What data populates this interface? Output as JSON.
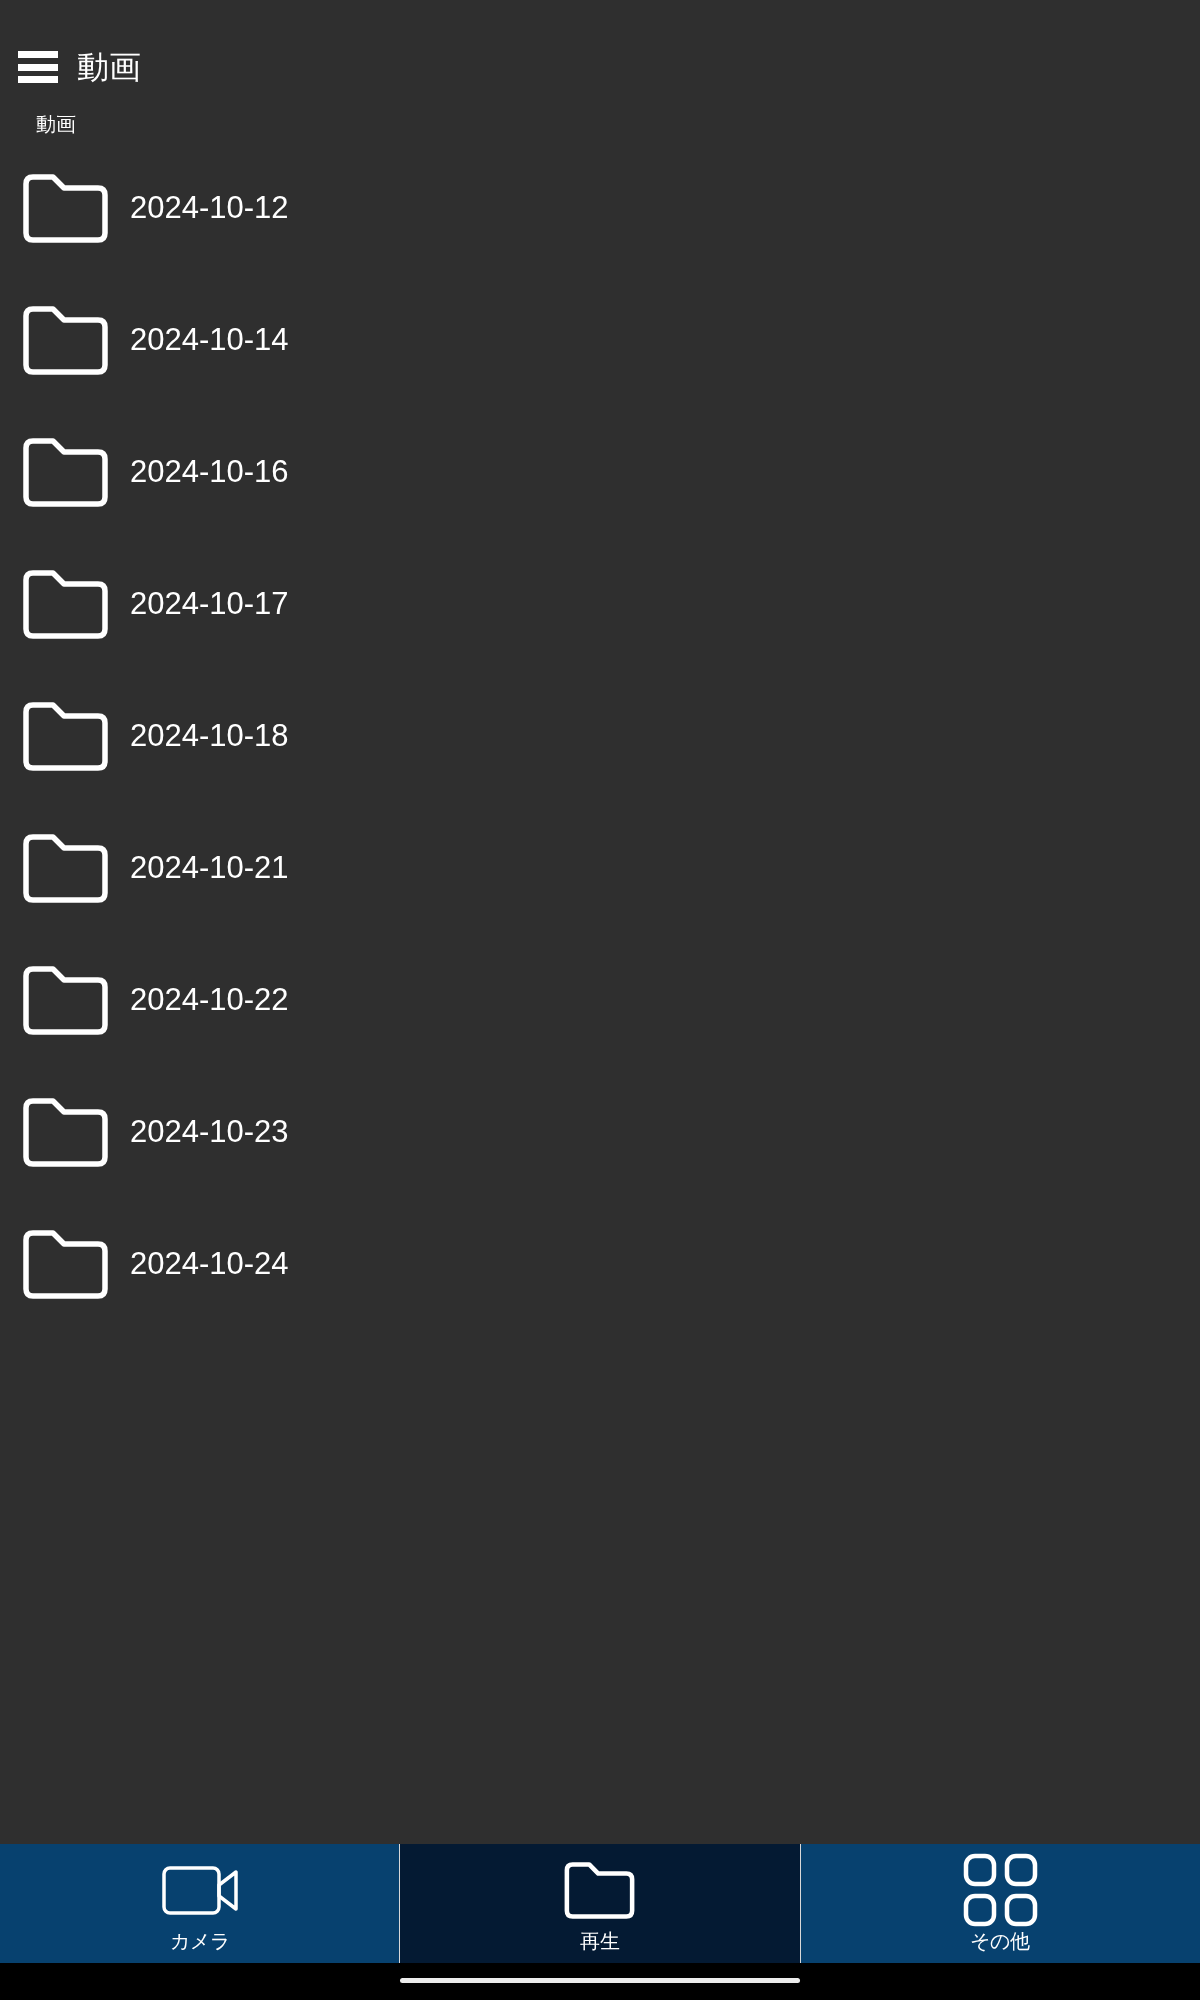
{
  "header": {
    "title": "動画"
  },
  "breadcrumb": "動画",
  "folders": [
    "2024-10-12",
    "2024-10-14",
    "2024-10-16",
    "2024-10-17",
    "2024-10-18",
    "2024-10-21",
    "2024-10-22",
    "2024-10-23",
    "2024-10-24"
  ],
  "bottom_nav": [
    {
      "kind": "camera",
      "label": "カメラ",
      "selected": false
    },
    {
      "kind": "folder",
      "label": "再生",
      "selected": true
    },
    {
      "kind": "apps",
      "label": "その他",
      "selected": false
    }
  ]
}
